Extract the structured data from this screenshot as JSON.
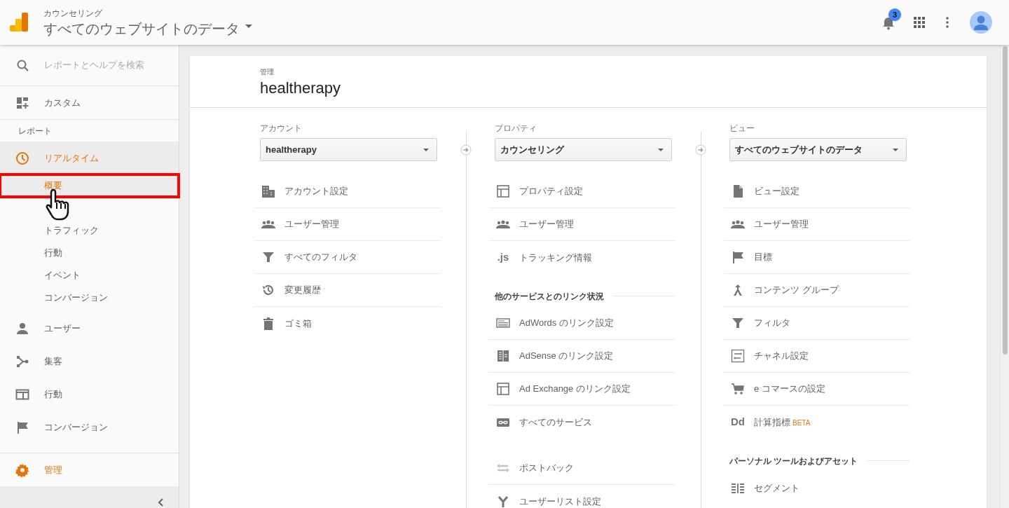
{
  "header": {
    "account": "カウンセリング",
    "view": "すべてのウェブサイトのデータ",
    "notification_count": "3"
  },
  "search": {
    "placeholder": "レポートとヘルプを検索"
  },
  "sidebar": {
    "top_items": [
      {
        "kind": "dashboard",
        "label": "カスタム",
        "selected": false
      }
    ],
    "section_label": "レポート",
    "items": [
      {
        "kind": "clock",
        "label": "リアルタイム",
        "selected": true,
        "expanded": true,
        "children": [
          {
            "label": "概要",
            "selected": true,
            "highlighted": true
          },
          {
            "label": "トラフィック",
            "selected": false,
            "highlighted": false
          },
          {
            "label": "行動",
            "selected": false,
            "highlighted": false
          },
          {
            "label": "イベント",
            "selected": false,
            "highlighted": false
          },
          {
            "label": "コンバージョン",
            "selected": false,
            "highlighted": false
          }
        ]
      },
      {
        "kind": "person",
        "label": "ユーザー",
        "selected": false
      },
      {
        "kind": "fork",
        "label": "集客",
        "selected": false
      },
      {
        "kind": "browser",
        "label": "行動",
        "selected": false
      },
      {
        "kind": "flag",
        "label": "コンバージョン",
        "selected": false
      }
    ],
    "admin": {
      "kind": "gear",
      "label": "管理",
      "selected": true
    }
  },
  "card": {
    "breadcrumb": "管理",
    "title": "healtherapy",
    "columns": [
      {
        "label": "アカウント",
        "value": "healtherapy",
        "sections": [
          {
            "items": [
              {
                "kind": "building",
                "label": "アカウント設定"
              },
              {
                "kind": "people",
                "label": "ユーザー管理"
              },
              {
                "kind": "filter",
                "label": "すべてのフィルタ"
              },
              {
                "kind": "history",
                "label": "変更履歴"
              },
              {
                "kind": "trash",
                "label": "ゴミ箱"
              }
            ]
          }
        ]
      },
      {
        "label": "プロパティ",
        "value": "カウンセリング",
        "sections": [
          {
            "items": [
              {
                "kind": "window",
                "label": "プロパティ設定"
              },
              {
                "kind": "people",
                "label": "ユーザー管理"
              },
              {
                "kind": "text",
                "icon_text": ".js",
                "label": "トラッキング情報"
              }
            ]
          },
          {
            "title": "他のサービスとのリンク状況",
            "items": [
              {
                "kind": "lines",
                "label": "AdWords のリンク設定"
              },
              {
                "kind": "columns",
                "label": "AdSense のリンク設定"
              },
              {
                "kind": "window",
                "label": "Ad Exchange のリンク設定"
              },
              {
                "kind": "link",
                "label": "すべてのサービス"
              }
            ]
          },
          {
            "items": [
              {
                "kind": "swap",
                "label": "ポストバック"
              },
              {
                "kind": "merge",
                "label": "ユーザーリスト設定"
              }
            ]
          }
        ]
      },
      {
        "label": "ビュー",
        "value": "すべてのウェブサイトのデータ",
        "sections": [
          {
            "items": [
              {
                "kind": "document",
                "label": "ビュー設定"
              },
              {
                "kind": "people",
                "label": "ユーザー管理"
              },
              {
                "kind": "flag",
                "label": "目標"
              },
              {
                "kind": "group",
                "label": "コンテンツ グループ"
              },
              {
                "kind": "filter",
                "label": "フィルタ"
              },
              {
                "kind": "channel",
                "label": "チャネル設定"
              },
              {
                "kind": "cart",
                "label": "e コマースの設定"
              },
              {
                "kind": "text",
                "icon_text": "Dd",
                "label": "計算指標",
                "badge": "BETA"
              }
            ]
          },
          {
            "title": "パーソナル ツールおよびアセット",
            "items": [
              {
                "kind": "segment",
                "label": "セグメント"
              }
            ]
          }
        ]
      }
    ]
  }
}
